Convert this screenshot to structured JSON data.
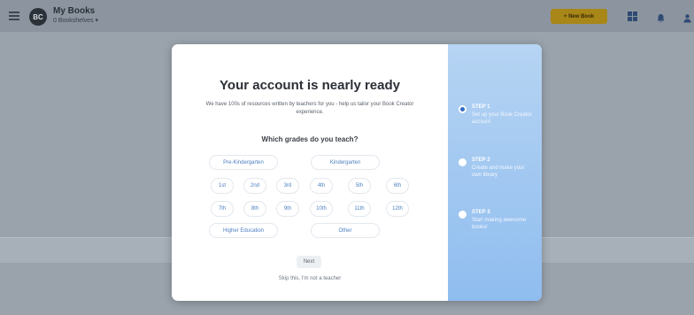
{
  "topbar": {
    "title": "My Books",
    "subtitle": "0 Bookshelves ▾",
    "logo_text": "BC",
    "new_book_label": "+ New Book"
  },
  "modal": {
    "title": "Your account is nearly ready",
    "description": "We have 100s of resources written by teachers for you - help us tailor your Book Creator experience.",
    "question": "Which grades do you teach?",
    "grades_wide_top": [
      "Pre-Kindergarten",
      "Kindergarten"
    ],
    "grades_row1": [
      "1st",
      "2nd",
      "3rd",
      "4th",
      "5th",
      "6th"
    ],
    "grades_row2": [
      "7th",
      "8th",
      "9th",
      "10th",
      "11th",
      "12th"
    ],
    "grades_wide_bottom": [
      "Higher Education",
      "Other"
    ],
    "next_label": "Next",
    "skip_label": "Skip this, I'm not a teacher"
  },
  "steps": [
    {
      "label": "STEP 1",
      "text": "Set up your Book Creator account",
      "active": true
    },
    {
      "label": "STEP 2",
      "text": "Create and make your own library",
      "active": false
    },
    {
      "label": "STEP 3",
      "text": "Start making awesome books!",
      "active": false
    }
  ],
  "colors": {
    "accent": "#2f6dc4",
    "new_book_button": "#a88617",
    "chip_text": "#4c7fc0"
  },
  "icons": [
    "menu-icon",
    "grid-icon",
    "bell-icon",
    "user-icon"
  ]
}
